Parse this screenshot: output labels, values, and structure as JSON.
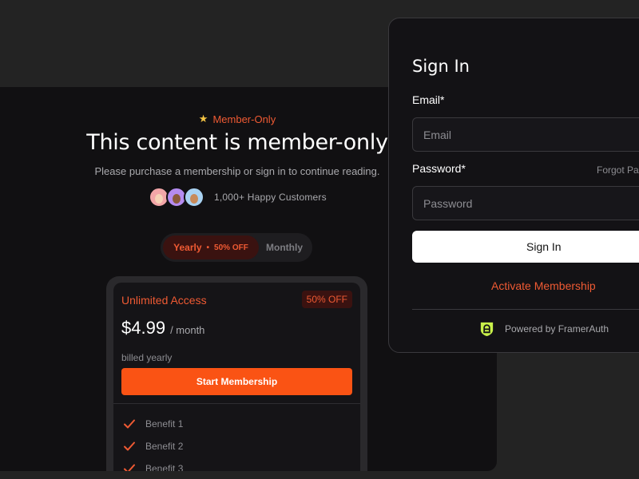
{
  "paywall": {
    "badge": "Member-Only",
    "headline": "This content is member-only",
    "subline": "Please purchase a membership or sign in to continue reading.",
    "customers_text": "1,000+ Happy Customers",
    "toggle": {
      "yearly_label": "Yearly",
      "yearly_separator": "•",
      "yearly_discount": "50% OFF",
      "monthly_label": "Monthly",
      "selected": "Yearly"
    },
    "plan": {
      "title": "Unlimited Access",
      "discount": "50% OFF",
      "price": "$4.99",
      "period": "/ month",
      "billing": "billed yearly",
      "cta": "Start Membership",
      "benefits": [
        "Benefit 1",
        "Benefit 2",
        "Benefit 3"
      ]
    }
  },
  "signin": {
    "title": "Sign In",
    "email_label": "Email*",
    "email_placeholder": "Email",
    "password_label": "Password*",
    "password_placeholder": "Password",
    "forgot_text": "Forgot Pa",
    "submit_label": "Sign In",
    "activate_label": "Activate Membership",
    "powered_text": "Powered by FramerAuth"
  },
  "colors": {
    "accent": "#ef5a33",
    "button": "#fa5314",
    "star": "#f6c544",
    "brand_logo": "#c8f04a"
  },
  "icons": [
    "star-icon",
    "check-icon",
    "shield-icon"
  ]
}
